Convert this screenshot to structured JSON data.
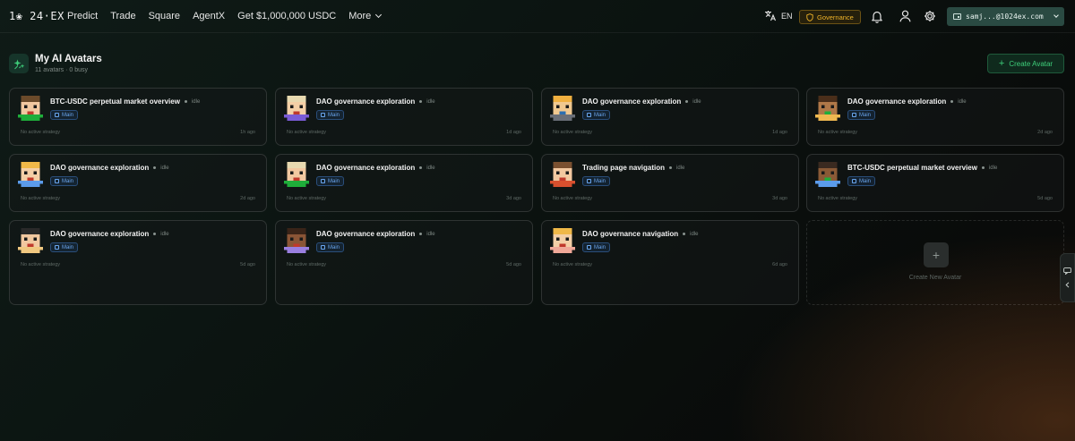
{
  "topbar": {
    "logo": "1❀ 24·EX",
    "nav": [
      "Predict",
      "Trade",
      "Square",
      "AgentX",
      "Get $1,000,000 USDC"
    ],
    "more_label": "More",
    "lang_label": "EN",
    "governance_label": "Governance",
    "wallet_label": "samj...@1024ex.com",
    "icons": [
      "translate-icon",
      "shield-icon",
      "bell-icon",
      "user-icon",
      "gear-icon",
      "wallet-icon"
    ]
  },
  "header": {
    "title": "My AI Avatars",
    "subtitle": "11 avatars · 0 busy",
    "create_label": "Create Avatar"
  },
  "colors": {
    "accent_green": "#3ecf7a",
    "badge_blue": "#6aa6ee",
    "gov_gold": "#f0b429"
  },
  "cards": [
    {
      "title": "BTC-USDC perpetual market overview",
      "status": "idle",
      "badge": "Main",
      "strategy": "No active strategy",
      "ago": "1h ago",
      "avatar": {
        "hair": "#6b4a2a",
        "skin": "#f2c8a0",
        "shirt": "#1fae3a",
        "mouth": "#c0392b"
      }
    },
    {
      "title": "DAO governance exploration",
      "status": "idle",
      "badge": "Main",
      "strategy": "No active strategy",
      "ago": "1d ago",
      "avatar": {
        "hair": "#e8d9b0",
        "skin": "#f4cfa6",
        "shirt": "#7a5bd6",
        "mouth": "#c0392b"
      }
    },
    {
      "title": "DAO governance exploration",
      "status": "idle",
      "badge": "Main",
      "strategy": "No active strategy",
      "ago": "1d ago",
      "avatar": {
        "hair": "#f0b040",
        "skin": "#f0c890",
        "shirt": "#6a6f78",
        "mouth": "#2d6fb0"
      }
    },
    {
      "title": "DAO governance exploration",
      "status": "idle",
      "badge": "Main",
      "strategy": "No active strategy",
      "ago": "2d ago",
      "avatar": {
        "hair": "#4a2e1a",
        "skin": "#b07848",
        "shirt": "#f0b850",
        "mouth": "#1fae3a"
      }
    },
    {
      "title": "DAO governance exploration",
      "status": "idle",
      "badge": "Main",
      "strategy": "No active strategy",
      "ago": "2d ago",
      "avatar": {
        "hair": "#f0b848",
        "skin": "#f4cfa6",
        "shirt": "#5b9bea",
        "mouth": "#c0392b"
      }
    },
    {
      "title": "DAO governance exploration",
      "status": "idle",
      "badge": "Main",
      "strategy": "No active strategy",
      "ago": "3d ago",
      "avatar": {
        "hair": "#e8d9b0",
        "skin": "#f2c8a0",
        "shirt": "#1fae3a",
        "mouth": "#c0392b"
      }
    },
    {
      "title": "Trading page navigation",
      "status": "idle",
      "badge": "Main",
      "strategy": "No active strategy",
      "ago": "3d ago",
      "avatar": {
        "hair": "#7a5030",
        "skin": "#f2c8a0",
        "shirt": "#d8502e",
        "mouth": "#c0392b"
      }
    },
    {
      "title": "BTC-USDC perpetual market overview",
      "status": "idle",
      "badge": "Main",
      "strategy": "No active strategy",
      "ago": "5d ago",
      "avatar": {
        "hair": "#3a2a20",
        "skin": "#8a5a36",
        "shirt": "#5b9bea",
        "mouth": "#1fae3a"
      }
    },
    {
      "title": "DAO governance exploration",
      "status": "idle",
      "badge": "Main",
      "strategy": "No active strategy",
      "ago": "5d ago",
      "avatar": {
        "hair": "#2a2a2a",
        "skin": "#f2c8a0",
        "shirt": "#f0c880",
        "mouth": "#c0392b"
      }
    },
    {
      "title": "DAO governance exploration",
      "status": "idle",
      "badge": "Main",
      "strategy": "No active strategy",
      "ago": "5d ago",
      "avatar": {
        "hair": "#3a2418",
        "skin": "#8a5536",
        "shirt": "#9a7fe0",
        "mouth": "#c0392b"
      }
    },
    {
      "title": "DAO governance navigation",
      "status": "idle",
      "badge": "Main",
      "strategy": "No active strategy",
      "ago": "6d ago",
      "avatar": {
        "hair": "#f0b848",
        "skin": "#f4cfa6",
        "shirt": "#f0a898",
        "mouth": "#c0392b"
      }
    }
  ],
  "new_card": {
    "label": "Create New Avatar"
  }
}
